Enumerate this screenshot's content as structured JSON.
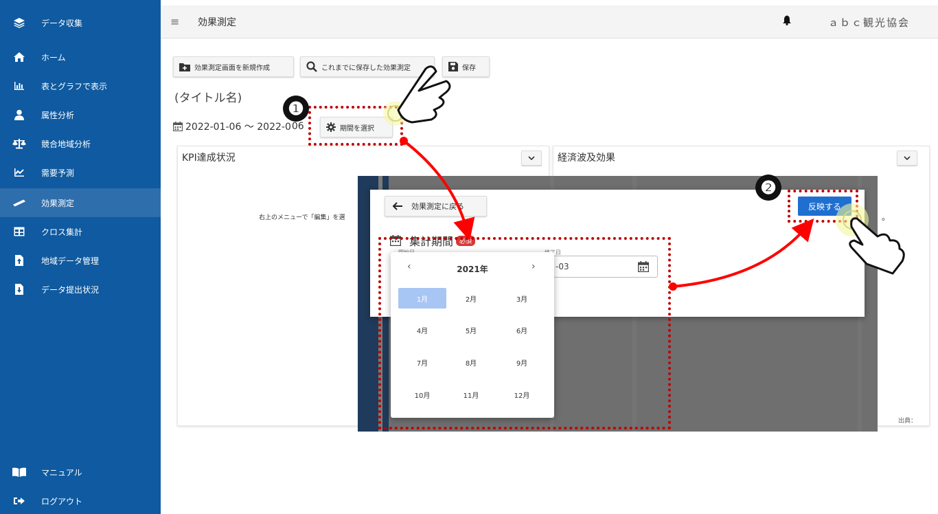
{
  "sidebar": {
    "header": "データ収集",
    "items": [
      {
        "label": "ホーム",
        "icon": "home-icon"
      },
      {
        "label": "表とグラフで表示",
        "icon": "bar-chart-icon"
      },
      {
        "label": "属性分析",
        "icon": "user-icon"
      },
      {
        "label": "競合地域分析",
        "icon": "balance-scale-icon"
      },
      {
        "label": "需要予測",
        "icon": "line-chart-icon"
      },
      {
        "label": "効果測定",
        "icon": "ruler-icon"
      },
      {
        "label": "クロス集計",
        "icon": "table-icon"
      },
      {
        "label": "地域データ管理",
        "icon": "file-upload-icon"
      },
      {
        "label": "データ提出状況",
        "icon": "file-download-icon"
      }
    ],
    "footer": [
      {
        "label": "マニュアル",
        "icon": "book-icon"
      },
      {
        "label": "ログアウト",
        "icon": "logout-icon"
      }
    ]
  },
  "topbar": {
    "title": "効果測定",
    "org": "ａｂｃ観光協会"
  },
  "toolbar": {
    "new_label": "効果測定画面を新規作成",
    "saved_label": "これまでに保存した効果測定",
    "save_label": "保存"
  },
  "page": {
    "title": "(タイトル名)",
    "period": "2022-01-06 ～ 2022-0",
    "period_suffix": "06",
    "select_period_label": "期間を選択"
  },
  "cards": {
    "kpi_title": "KPI達成状況",
    "kpi_hint": "右上のメニューで「編集」を選",
    "econ_title": "経済波及効果",
    "econ_hint": "。",
    "source_label": "出典："
  },
  "dialog": {
    "back_label": "効果測定に戻る",
    "apply_label": "反映する",
    "section_label": "集計期間",
    "badge": "必須",
    "start_label": "開始日",
    "end_label": "終了日",
    "end_value": "-03"
  },
  "calendar": {
    "year": "2021年",
    "prev": "‹",
    "next": "›",
    "months": [
      "1月",
      "2月",
      "3月",
      "4月",
      "5月",
      "6月",
      "7月",
      "8月",
      "9月",
      "10月",
      "11月",
      "12月"
    ],
    "selected": "1月"
  },
  "annotations": {
    "step1": "❶",
    "step2": "❷"
  },
  "colors": {
    "sidebar": "#0f5aa0",
    "sidebar_active": "#2e6eac",
    "apply": "#1f6fd0",
    "annotation": "#c00000",
    "selected_month": "#a8c6f3"
  }
}
